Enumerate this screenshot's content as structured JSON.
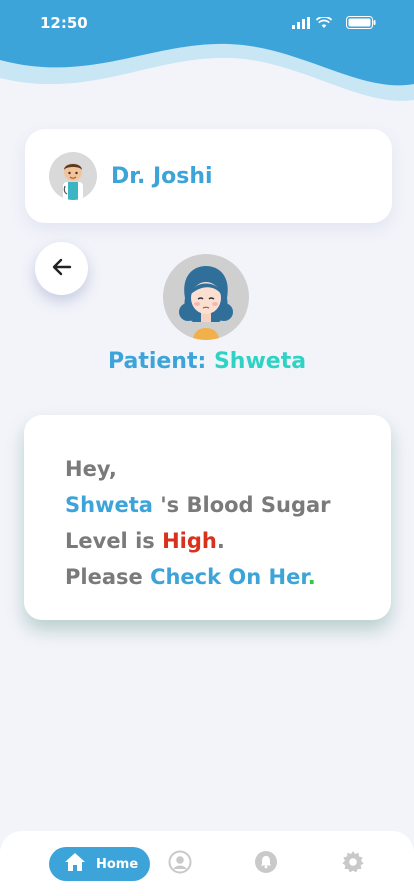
{
  "status_bar": {
    "time": "12:50"
  },
  "doctor": {
    "name": "Dr. Joshi"
  },
  "patient": {
    "prefix": "Patient: ",
    "name": "Shweta"
  },
  "alert": {
    "greeting": "Hey,",
    "patient_name": "Shweta",
    "line2_rest": " 's Blood Sugar",
    "line3_prefix": "Level is ",
    "level": "High",
    "line3_suffix": ".",
    "line4_prefix": "Please ",
    "action": "Check On Her",
    "line4_suffix": "."
  },
  "nav": {
    "home_label": "Home",
    "items": [
      "home-icon",
      "profile-icon",
      "bell-icon",
      "gear-icon"
    ]
  },
  "colors": {
    "primary": "#3ca4d8",
    "teal": "#2fd3c4",
    "alert_red": "#d8311c",
    "background": "#f3f4fa"
  }
}
